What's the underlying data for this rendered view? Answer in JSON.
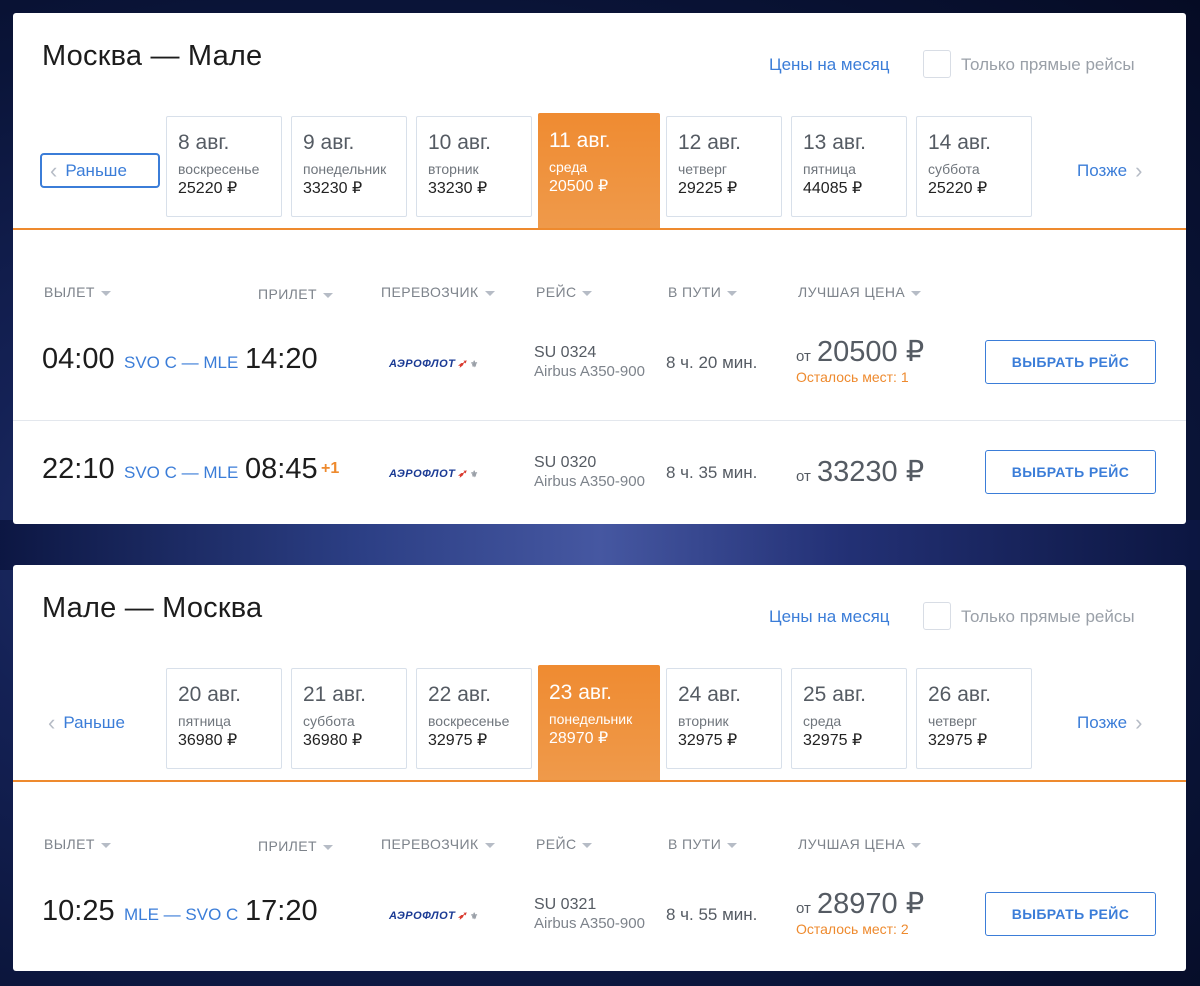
{
  "panels": [
    {
      "title": "Москва — Мале",
      "month_prices_link": "Цены на месяц",
      "direct_only_label": "Только прямые рейсы",
      "prev_label": "Раньше",
      "next_label": "Позже",
      "dates": [
        {
          "date": "8 авг.",
          "weekday": "воскресенье",
          "price": "25220 ₽"
        },
        {
          "date": "9 авг.",
          "weekday": "понедельник",
          "price": "33230 ₽"
        },
        {
          "date": "10 авг.",
          "weekday": "вторник",
          "price": "33230 ₽"
        },
        {
          "date": "11 авг.",
          "weekday": "среда",
          "price": "20500 ₽",
          "selected": true
        },
        {
          "date": "12 авг.",
          "weekday": "четверг",
          "price": "29225 ₽"
        },
        {
          "date": "13 авг.",
          "weekday": "пятница",
          "price": "44085 ₽"
        },
        {
          "date": "14 авг.",
          "weekday": "суббота",
          "price": "25220 ₽"
        }
      ],
      "columns": {
        "departure": "ВЫЛЕТ",
        "arrival": "ПРИЛЕТ",
        "carrier": "ПЕРЕВОЗЧИК",
        "flight": "РЕЙС",
        "duration": "В ПУТИ",
        "best_price": "ЛУЧШАЯ ЦЕНА"
      },
      "flights": [
        {
          "dep": "04:00",
          "route": "SVO C — MLE",
          "arr": "14:20",
          "plus_day": "",
          "airline": "АЭРОФЛОТ",
          "flight_no": "SU 0324",
          "aircraft": "Airbus A350-900",
          "duration": "8 ч. 20 мин.",
          "price_prefix": "от",
          "price": "20500 ₽",
          "seats": "Осталось мест: 1",
          "button": "ВЫБРАТЬ РЕЙС"
        },
        {
          "dep": "22:10",
          "route": "SVO C — MLE",
          "arr": "08:45",
          "plus_day": "+1",
          "airline": "АЭРОФЛОТ",
          "flight_no": "SU 0320",
          "aircraft": "Airbus A350-900",
          "duration": "8 ч. 35 мин.",
          "price_prefix": "от",
          "price": "33230 ₽",
          "seats": "",
          "button": "ВЫБРАТЬ РЕЙС"
        }
      ]
    },
    {
      "title": "Мале — Москва",
      "month_prices_link": "Цены на месяц",
      "direct_only_label": "Только прямые рейсы",
      "prev_label": "Раньше",
      "next_label": "Позже",
      "dates": [
        {
          "date": "20 авг.",
          "weekday": "пятница",
          "price": "36980 ₽"
        },
        {
          "date": "21 авг.",
          "weekday": "суббота",
          "price": "36980 ₽"
        },
        {
          "date": "22 авг.",
          "weekday": "воскресенье",
          "price": "32975 ₽"
        },
        {
          "date": "23 авг.",
          "weekday": "понедельник",
          "price": "28970 ₽",
          "selected": true
        },
        {
          "date": "24 авг.",
          "weekday": "вторник",
          "price": "32975 ₽"
        },
        {
          "date": "25 авг.",
          "weekday": "среда",
          "price": "32975 ₽"
        },
        {
          "date": "26 авг.",
          "weekday": "четверг",
          "price": "32975 ₽"
        }
      ],
      "columns": {
        "departure": "ВЫЛЕТ",
        "arrival": "ПРИЛЕТ",
        "carrier": "ПЕРЕВОЗЧИК",
        "flight": "РЕЙС",
        "duration": "В ПУТИ",
        "best_price": "ЛУЧШАЯ ЦЕНА"
      },
      "flights": [
        {
          "dep": "10:25",
          "route": "MLE — SVO C",
          "arr": "17:20",
          "plus_day": "",
          "airline": "АЭРОФЛОТ",
          "flight_no": "SU 0321",
          "aircraft": "Airbus A350-900",
          "duration": "8 ч. 55 мин.",
          "price_prefix": "от",
          "price": "28970 ₽",
          "seats": "Осталось мест: 2",
          "button": "ВЫБРАТЬ РЕЙС"
        }
      ]
    }
  ],
  "colors": {
    "accent": "#3b7dd8",
    "selected_date": "#ef8b31",
    "warning": "#ee8a2e"
  }
}
